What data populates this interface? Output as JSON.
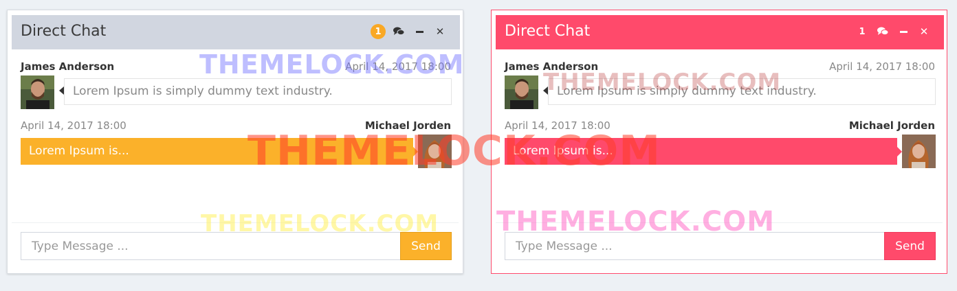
{
  "chats": [
    {
      "title": "Direct Chat",
      "badge": "1",
      "icons": {
        "messages": "comments-icon",
        "minimize": "minus-icon",
        "close": "times-icon"
      },
      "messages": [
        {
          "name": "James Anderson",
          "time": "April 14, 2017 18:00",
          "text": "Lorem Ipsum is simply dummy text industry."
        },
        {
          "name": "Michael Jorden",
          "time": "April 14, 2017 18:00",
          "text": "Lorem Ipsum is..."
        }
      ],
      "input_placeholder": "Type Message ...",
      "send_label": "Send",
      "accent": "#fbb12a"
    },
    {
      "title": "Direct Chat",
      "badge": "1",
      "icons": {
        "messages": "comments-icon",
        "minimize": "minus-icon",
        "close": "times-icon"
      },
      "messages": [
        {
          "name": "James Anderson",
          "time": "April 14, 2017 18:00",
          "text": "Lorem Ipsum is simply dummy text industry."
        },
        {
          "name": "Michael Jorden",
          "time": "April 14, 2017 18:00",
          "text": "Lorem Ipsum is..."
        }
      ],
      "input_placeholder": "Type Message ...",
      "send_label": "Send",
      "accent": "#ff4a6b"
    }
  ],
  "watermarks": [
    "THEMELOCK.COM",
    "THEMELOCK.COM",
    "THEMELOCK.COM",
    "THEMELOCK.COM",
    "THEMELOCK.COM"
  ]
}
